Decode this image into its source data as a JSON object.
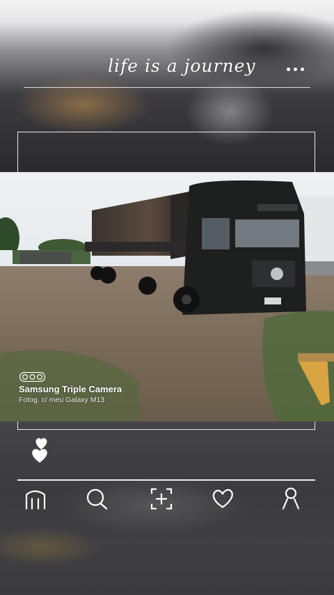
{
  "header": {
    "title": "life is a journey",
    "more_icon": "more-horizontal-icon"
  },
  "photo": {
    "description_icon": "truck-photo",
    "camera_badge_icon": "triple-camera-icon",
    "camera_title": "Samsung Triple Camera",
    "camera_subtitle": "Fotog. c/ meu Galaxy M13"
  },
  "actions": {
    "like_icon": "double-heart-icon"
  },
  "nav": {
    "items": [
      {
        "icon": "home-icon"
      },
      {
        "icon": "search-icon"
      },
      {
        "icon": "add-post-icon"
      },
      {
        "icon": "heart-icon"
      },
      {
        "icon": "profile-icon"
      }
    ]
  },
  "colors": {
    "line": "#ffffff",
    "truck": "#1e1f1f"
  }
}
